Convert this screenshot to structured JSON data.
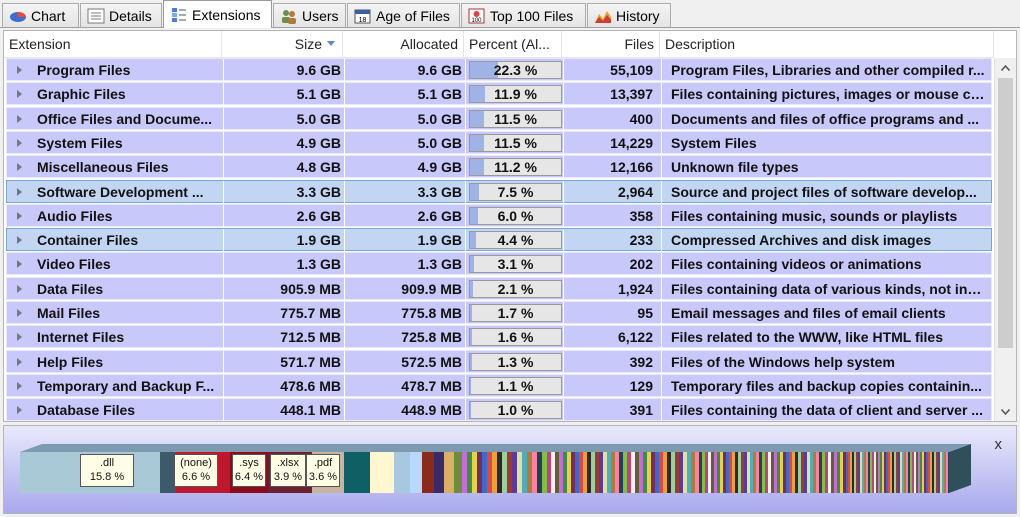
{
  "tabs": [
    {
      "label": "Chart",
      "icon": "pie-chart-icon"
    },
    {
      "label": "Details",
      "icon": "details-list-icon"
    },
    {
      "label": "Extensions",
      "icon": "extensions-icon"
    },
    {
      "label": "Users",
      "icon": "users-icon"
    },
    {
      "label": "Age of Files",
      "icon": "calendar-icon"
    },
    {
      "label": "Top 100 Files",
      "icon": "top100-icon"
    },
    {
      "label": "History",
      "icon": "history-chart-icon"
    }
  ],
  "table": {
    "columns": {
      "extension": "Extension",
      "size": "Size",
      "allocated": "Allocated",
      "percent": "Percent (Al...",
      "files": "Files",
      "description": "Description"
    },
    "rows": [
      {
        "name": "Program Files",
        "size": "9.6 GB",
        "allocated": "9.6 GB",
        "percent": "22.3 %",
        "pct": 22.3,
        "files": "55,109",
        "description": "Program Files, Libraries and other compiled r..."
      },
      {
        "name": "Graphic Files",
        "size": "5.1 GB",
        "allocated": "5.1 GB",
        "percent": "11.9 %",
        "pct": 11.9,
        "files": "13,397",
        "description": "Files containing pictures, images or mouse cu..."
      },
      {
        "name": "Office Files and Docume...",
        "size": "5.0 GB",
        "allocated": "5.0 GB",
        "percent": "11.5 %",
        "pct": 11.5,
        "files": "400",
        "description": "Documents and files of office programs and ..."
      },
      {
        "name": "System Files",
        "size": "4.9 GB",
        "allocated": "5.0 GB",
        "percent": "11.5 %",
        "pct": 11.5,
        "files": "14,229",
        "description": "System Files"
      },
      {
        "name": "Miscellaneous Files",
        "size": "4.8 GB",
        "allocated": "4.9 GB",
        "percent": "11.2 %",
        "pct": 11.2,
        "files": "12,166",
        "description": "Unknown file types"
      },
      {
        "name": "Software Development ...",
        "size": "3.3 GB",
        "allocated": "3.3 GB",
        "percent": "7.5 %",
        "pct": 7.5,
        "files": "2,964",
        "description": "Source and project files of software develop...",
        "selected": true
      },
      {
        "name": "Audio Files",
        "size": "2.6 GB",
        "allocated": "2.6 GB",
        "percent": "6.0 %",
        "pct": 6.0,
        "files": "358",
        "description": "Files containing music, sounds or playlists"
      },
      {
        "name": "Container Files",
        "size": "1.9 GB",
        "allocated": "1.9 GB",
        "percent": "4.4 %",
        "pct": 4.4,
        "files": "233",
        "description": "Compressed Archives and disk images",
        "selected": true
      },
      {
        "name": "Video Files",
        "size": "1.3 GB",
        "allocated": "1.3 GB",
        "percent": "3.1 %",
        "pct": 3.1,
        "files": "202",
        "description": "Files containing videos or animations"
      },
      {
        "name": "Data Files",
        "size": "905.9 MB",
        "allocated": "909.9 MB",
        "percent": "2.1 %",
        "pct": 2.1,
        "files": "1,924",
        "description": "Files containing data of various kinds, not incl..."
      },
      {
        "name": "Mail Files",
        "size": "775.7 MB",
        "allocated": "775.8 MB",
        "percent": "1.7 %",
        "pct": 1.7,
        "files": "95",
        "description": "Email messages and files of email clients"
      },
      {
        "name": "Internet Files",
        "size": "712.5 MB",
        "allocated": "725.8 MB",
        "percent": "1.6 %",
        "pct": 1.6,
        "files": "6,122",
        "description": "Files related to the WWW, like HTML files"
      },
      {
        "name": "Help Files",
        "size": "571.7 MB",
        "allocated": "572.5 MB",
        "percent": "1.3 %",
        "pct": 1.3,
        "files": "392",
        "description": "Files of the Windows help system"
      },
      {
        "name": "Temporary and Backup F...",
        "size": "478.6 MB",
        "allocated": "478.7 MB",
        "percent": "1.1 %",
        "pct": 1.1,
        "files": "129",
        "description": "Temporary files and backup copies containin..."
      },
      {
        "name": "Database Files",
        "size": "448.1 MB",
        "allocated": "448.9 MB",
        "percent": "1.0 %",
        "pct": 1.0,
        "files": "391",
        "description": "Files containing the data of client and server ..."
      }
    ]
  },
  "treemap": {
    "close_label": "x",
    "labels": [
      {
        "ext": ".dll",
        "pct": "15.8 %"
      },
      {
        "ext": "(none)",
        "pct": "6.6 %"
      },
      {
        "ext": ".sys",
        "pct": "6.4 %"
      },
      {
        "ext": ".xlsx",
        "pct": "3.9 %"
      },
      {
        "ext": ".pdf",
        "pct": "3.6 %"
      }
    ]
  }
}
